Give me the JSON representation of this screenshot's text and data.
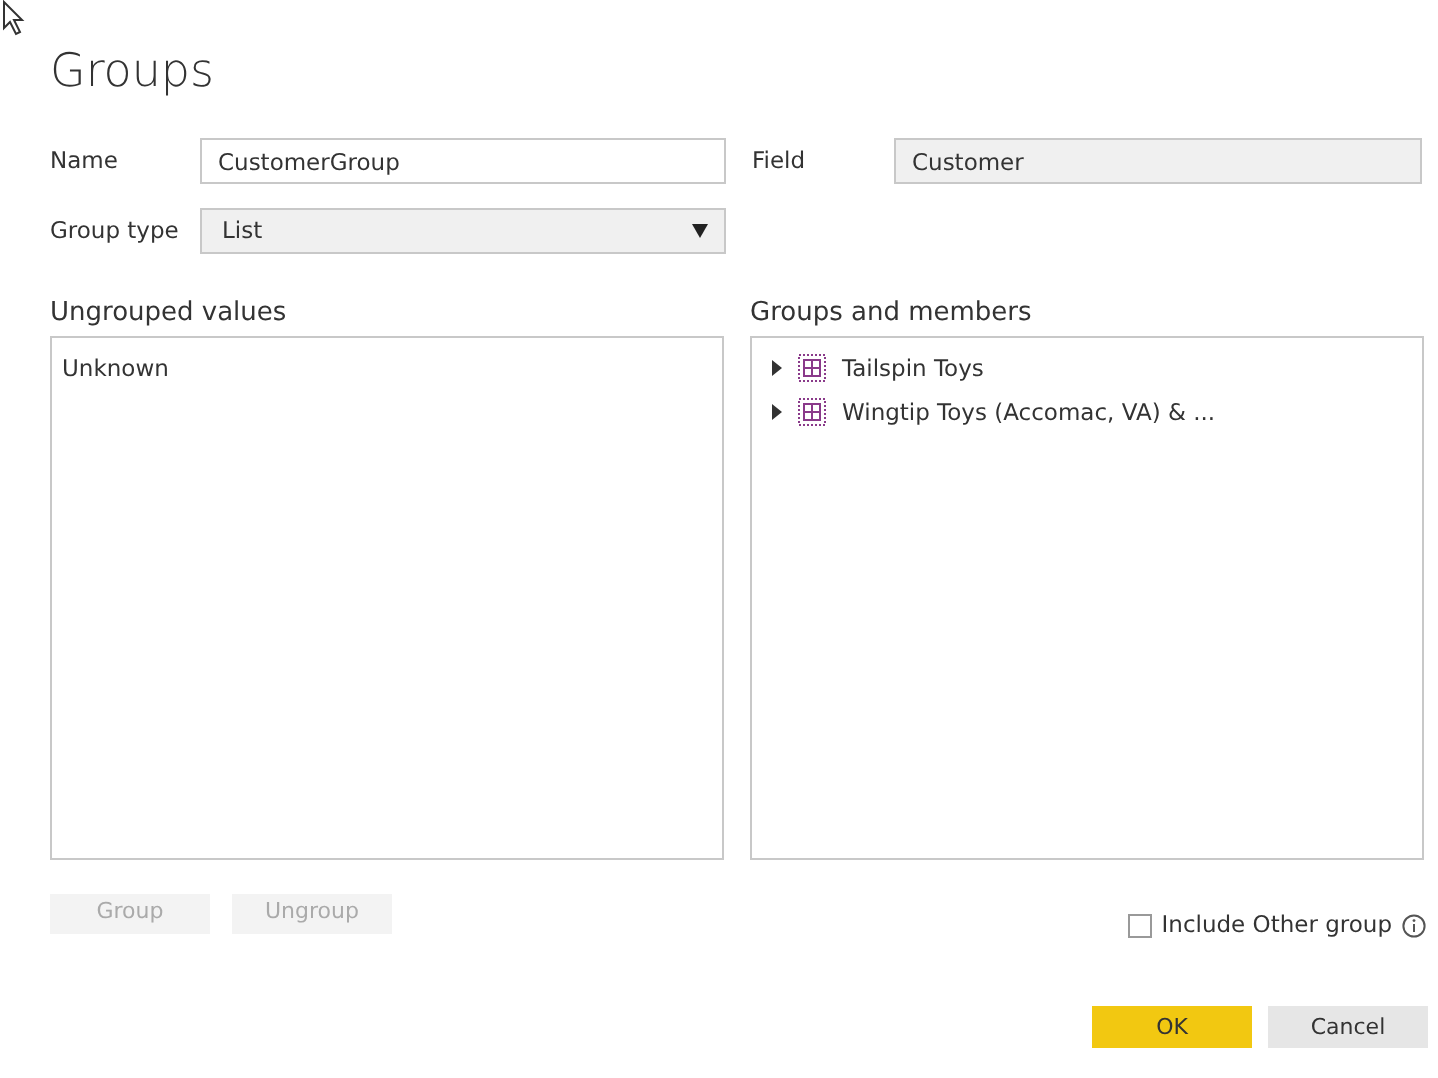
{
  "dialog": {
    "title": "Groups"
  },
  "name_field": {
    "label": "Name",
    "value": "CustomerGroup"
  },
  "field_field": {
    "label": "Field",
    "value": "Customer",
    "disabled": true
  },
  "group_type": {
    "label": "Group type",
    "value": "List"
  },
  "ungrouped": {
    "heading": "Ungrouped values",
    "items": [
      {
        "label": "Unknown",
        "selected": false
      }
    ]
  },
  "groups": {
    "heading": "Groups and members",
    "items": [
      {
        "label": "Tailspin Toys",
        "expanded": false
      },
      {
        "label": "Wingtip Toys (Accomac, VA) & ...",
        "expanded": false
      }
    ]
  },
  "action_buttons": [
    {
      "label": "Group",
      "disabled": true
    },
    {
      "label": "Ungroup",
      "disabled": true
    }
  ],
  "include_other": {
    "label": "Include Other group",
    "checked": false
  },
  "footer_buttons": [
    {
      "label": "OK",
      "kind": "primary"
    },
    {
      "label": "Cancel",
      "kind": "secondary"
    }
  ]
}
